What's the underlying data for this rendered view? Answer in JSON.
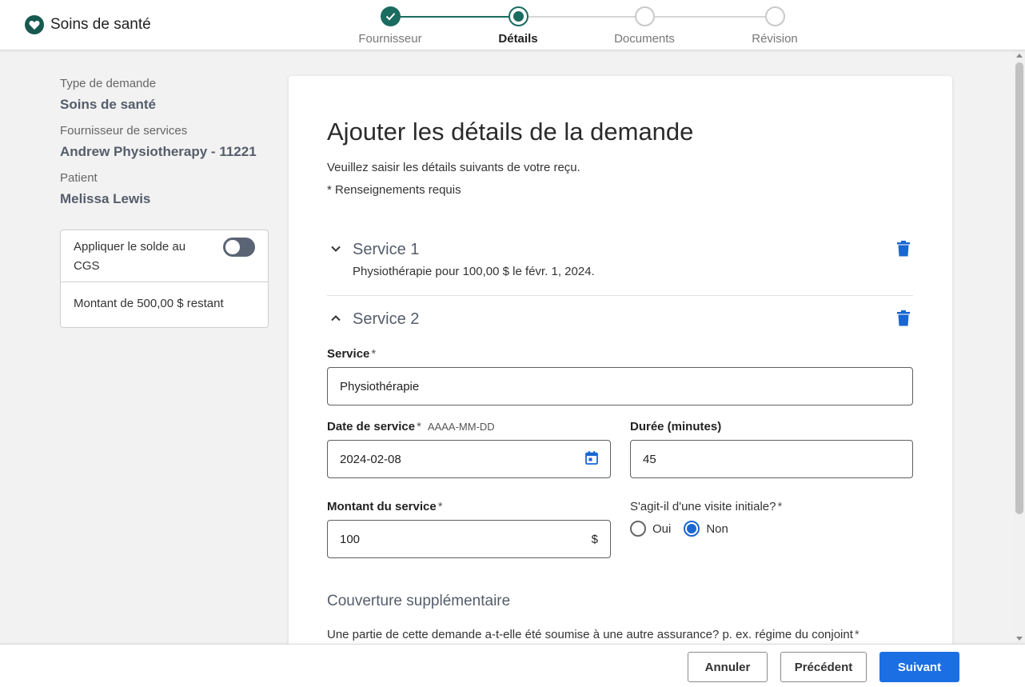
{
  "app": {
    "title": "Soins de santé",
    "brand_icon": "heart-icon",
    "colors": {
      "brand": "#17594f",
      "step_active": "#1a6b60",
      "primary": "#1b6fe3",
      "link_icon": "#1967d2"
    }
  },
  "stepper": {
    "steps": [
      {
        "label": "Fournisseur",
        "state": "done"
      },
      {
        "label": "Détails",
        "state": "current"
      },
      {
        "label": "Documents",
        "state": "todo"
      },
      {
        "label": "Révision",
        "state": "todo"
      }
    ]
  },
  "sidebar": {
    "claim_type_label": "Type de demande",
    "claim_type_value": "Soins de santé",
    "provider_label": "Fournisseur de services",
    "provider_value": "Andrew Physiotherapy - 11221",
    "patient_label": "Patient",
    "patient_value": "Melissa Lewis",
    "balance": {
      "toggle_label": "Appliquer le solde au CGS",
      "toggle_on": false,
      "remaining_text": "Montant de 500,00 $ restant"
    }
  },
  "main": {
    "title": "Ajouter les détails de la demande",
    "subtitle": "Veuillez saisir les détails suivants de votre reçu.",
    "required_note": "* Renseignements requis",
    "services": [
      {
        "title": "Service 1",
        "expanded": false,
        "summary": "Physiothérapie pour 100,00 $ le févr. 1, 2024."
      },
      {
        "title": "Service 2",
        "expanded": true,
        "service_label": "Service",
        "service_value": "Physiothérapie",
        "date_label": "Date de service",
        "date_hint": "AAAA-MM-DD",
        "date_value": "2024-02-08",
        "duration_label": "Durée (minutes)",
        "duration_value": "45",
        "amount_label": "Montant du service",
        "amount_value": "100",
        "amount_suffix": "$",
        "initial_visit_label": "S'agit-il d'une visite initiale?",
        "initial_visit_options": [
          "Oui",
          "Non"
        ],
        "initial_visit_selected": "Non"
      }
    ],
    "required_marker": "*",
    "coverage_title": "Couverture supplémentaire",
    "coverage_question": "Une partie de cette demande a-t-elle été soumise à une autre assurance? p. ex. régime du conjoint"
  },
  "footer": {
    "cancel_label": "Annuler",
    "previous_label": "Précédent",
    "next_label": "Suivant"
  }
}
